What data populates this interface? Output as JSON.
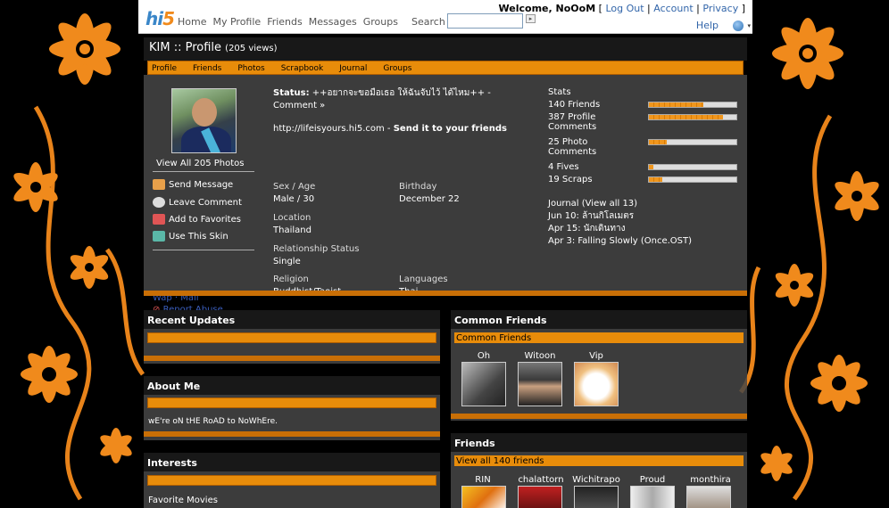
{
  "topbar": {
    "logo": "hi5",
    "nav": [
      "Home",
      "My Profile",
      "Friends",
      "Messages",
      "Groups"
    ],
    "search_label": "Search",
    "search_value": "",
    "welcome": "Welcome, NoOoM",
    "links": [
      "Log Out",
      "Account",
      "Privacy"
    ],
    "help": "Help"
  },
  "header": {
    "name": "KIM :: Profile",
    "views": "(205 views)"
  },
  "tabs": [
    "Profile",
    "Friends",
    "Photos",
    "Scrapbook",
    "Journal",
    "Groups"
  ],
  "profile": {
    "view_photos": "View All 205 Photos",
    "actions": [
      "Send Message",
      "Leave Comment",
      "Add to Favorites",
      "Use This Skin"
    ],
    "hidden_link": "Wap · Mail",
    "report": "Report Abuse",
    "status_label": "Status:",
    "status_text": "++อยากจะขอมือเธอ ให้ฉันจับไว้ ได้ไหม++ -",
    "comment_link": "Comment »",
    "url": "http://lifeisyours.hi5.com",
    "send_link": "Send it to your friends",
    "sex_age_label": "Sex / Age",
    "sex_age": "Male / 30",
    "birthday_label": "Birthday",
    "birthday": "December 22",
    "location_label": "Location",
    "location": "Thailand",
    "rel_label": "Relationship Status",
    "rel": "Single",
    "religion_label": "Religion",
    "religion": "Buddhist/Taoist",
    "languages_label": "Languages",
    "languages": "Thai"
  },
  "stats": {
    "title": "Stats",
    "rows": [
      {
        "label": "140 Friends",
        "level": 0.62
      },
      {
        "label": "387 Profile",
        "label2": "Comments",
        "level": 0.85
      },
      {
        "label": "25 Photo",
        "label2": "Comments",
        "level": 0.2
      },
      {
        "label": "4 Fives",
        "level": 0.05
      },
      {
        "label": "19 Scraps",
        "level": 0.15
      }
    ]
  },
  "journal": {
    "title": "Journal (View all 13)",
    "entries": [
      "Jun 10: ล้านกิโลเมตร",
      "Apr 15: นักเดินทาง",
      "Apr 3: Falling Slowly (Once.OST)"
    ]
  },
  "recent_updates": {
    "title": "Recent Updates"
  },
  "about": {
    "title": "About Me",
    "text": "wE're oN tHE RoAD to NoWhEre."
  },
  "interests": {
    "title": "Interests",
    "favorite_movies": "Favorite Movies"
  },
  "common": {
    "title": "Common Friends",
    "link": "Common Friends",
    "friends": [
      "Oh",
      "Witoon",
      "Vip"
    ]
  },
  "friends": {
    "title": "Friends",
    "link": "View all 140 friends",
    "names": [
      "RIN",
      "chalattorn",
      "Wichitrapo",
      "Proud",
      "monthira"
    ]
  },
  "colors": {
    "accent": "#e88c0a",
    "flower": "#f08a1c",
    "header": "#181818"
  }
}
